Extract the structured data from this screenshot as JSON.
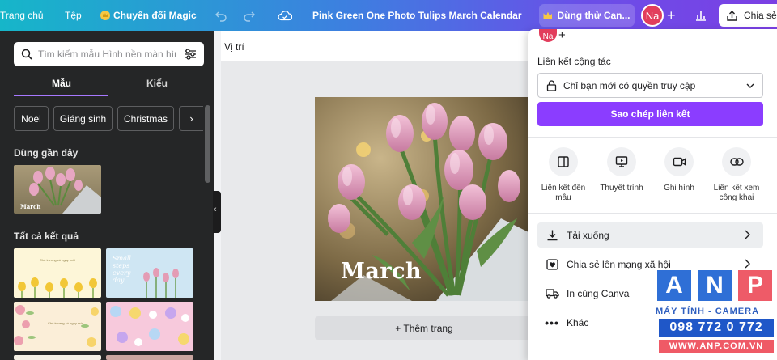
{
  "topbar": {
    "home": "Trang chủ",
    "file": "Tệp",
    "magic": "Chuyển đổi Magic",
    "title": "Pink Green One Photo Tulips March Calendar 20...",
    "try": "Dùng thử Can...",
    "avatar": "Na",
    "share": "Chia sẻ"
  },
  "sidebar": {
    "search_placeholder": "Tìm kiếm mẫu Hình nền màn hình c",
    "tabs": [
      "Mẫu",
      "Kiểu"
    ],
    "chips": [
      "Noel",
      "Giáng sinh",
      "Christmas"
    ],
    "recent_title": "Dùng gần đây",
    "recent_thumb_text": "March",
    "all_title": "Tất cả kết quả",
    "thumb_text_1": "Chủ trương có ngày mới",
    "thumb_text_2": "Small steps every day",
    "thumb_text_3": "Chủ trương có ngày mới"
  },
  "editor": {
    "position": "Vị trí",
    "canvas_text": "March",
    "add_page": "+ Thêm trang"
  },
  "share_panel": {
    "avatar": "Na",
    "collab_title": "Liên kết cộng tác",
    "access": "Chỉ bạn mới có quyền truy cập",
    "copy": "Sao chép liên kết",
    "options": [
      "Liên kết đến mẫu",
      "Thuyết trình",
      "Ghi hình",
      "Liên kết xem công khai"
    ],
    "rows": [
      "Tải xuống",
      "Chia sẻ lên mạng xã hội",
      "In cùng Canva",
      "Khác"
    ]
  },
  "watermark": {
    "letters": [
      "A",
      "N",
      "P"
    ],
    "line1": "MÁY TÍNH - CAMERA",
    "phone": "098 772 0 772",
    "url": "WWW.ANP.COM.VN"
  },
  "colors": {
    "primary": "#8b3dff",
    "dark": "#252627",
    "accent": "#16b6c9"
  }
}
